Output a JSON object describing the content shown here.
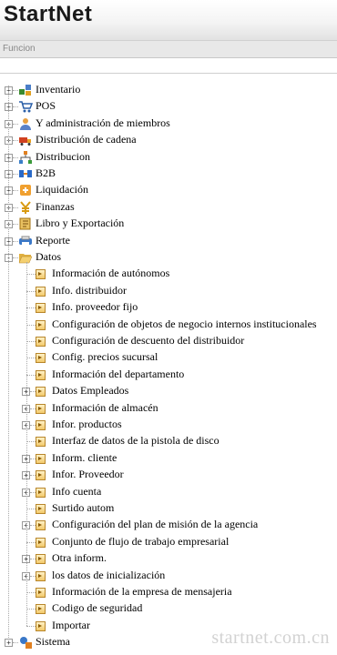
{
  "app": {
    "title": "StartNet",
    "section": "Funcion",
    "watermark": "startnet.com.cn"
  },
  "menu": [
    {
      "label": "Inventario",
      "icon": "inventory-icon"
    },
    {
      "label": "POS",
      "icon": "cart-icon"
    },
    {
      "label": "Y administración de miembros",
      "icon": "member-icon"
    },
    {
      "label": "Distribución de cadena",
      "icon": "truck-icon"
    },
    {
      "label": "Distribucion",
      "icon": "network-icon"
    },
    {
      "label": "B2B",
      "icon": "b2b-icon"
    },
    {
      "label": "Liquidación",
      "icon": "settlement-icon"
    },
    {
      "label": "Finanzas",
      "icon": "yen-icon"
    },
    {
      "label": "Libro y Exportación",
      "icon": "book-icon"
    },
    {
      "label": "Reporte",
      "icon": "report-icon"
    },
    {
      "label": "Datos",
      "icon": "folder-open-icon"
    }
  ],
  "datos_children": [
    {
      "label": "Información de autónomos",
      "expandable": false
    },
    {
      "label": "Info. distribuidor",
      "expandable": false
    },
    {
      "label": "Info. proveedor fijo",
      "expandable": false
    },
    {
      "label": "Configuración de objetos de negocio internos institucionales",
      "expandable": false
    },
    {
      "label": "Configuración de descuento del distribuidor",
      "expandable": false
    },
    {
      "label": "Config. precios sucursal",
      "expandable": false
    },
    {
      "label": "Información del departamento",
      "expandable": false
    },
    {
      "label": "Datos Empleados",
      "expandable": true
    },
    {
      "label": "Información de almacén",
      "expandable": true
    },
    {
      "label": "Infor. productos",
      "expandable": true
    },
    {
      "label": "Interfaz de datos de la pistola de disco",
      "expandable": false
    },
    {
      "label": "Inform. cliente",
      "expandable": true
    },
    {
      "label": "Infor. Proveedor",
      "expandable": true
    },
    {
      "label": "Info cuenta",
      "expandable": true
    },
    {
      "label": "Surtido autom",
      "expandable": false
    },
    {
      "label": "Configuración del plan de misión de la agencia",
      "expandable": true
    },
    {
      "label": "Conjunto de flujo de trabajo empresarial",
      "expandable": false
    },
    {
      "label": "Otra inform.",
      "expandable": true
    },
    {
      "label": "los datos de inicialización",
      "expandable": true
    },
    {
      "label": "Información de la empresa de mensajeria",
      "expandable": false
    },
    {
      "label": "Codigo de seguridad",
      "expandable": false
    },
    {
      "label": "Importar",
      "expandable": false
    }
  ],
  "last_menu": {
    "label": "Sistema",
    "icon": "system-icon"
  }
}
